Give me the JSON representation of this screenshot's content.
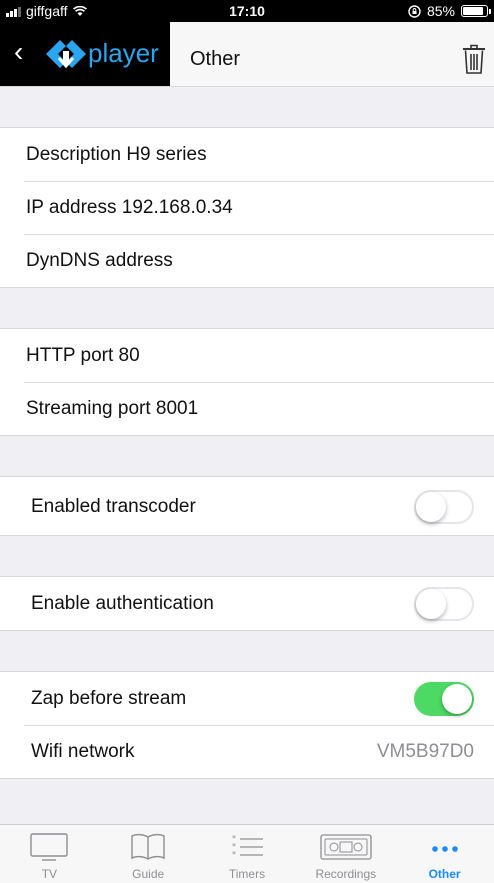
{
  "status_bar": {
    "carrier": "giffgaff",
    "time": "17:10",
    "battery_text": "85%",
    "battery_level": 0.85
  },
  "nav": {
    "app_name": "player",
    "title": "Other"
  },
  "settings": {
    "description": "Description  H9 series",
    "ip_address": "IP address  192.168.0.34",
    "dyndns": "DynDNS address",
    "http_port": "HTTP port  80",
    "streaming_port": "Streaming port  8001",
    "transcoder": {
      "label": "Enabled transcoder",
      "on": false
    },
    "authentication": {
      "label": "Enable authentication",
      "on": false
    },
    "zap": {
      "label": "Zap before stream",
      "on": true
    },
    "wifi": {
      "label": "Wifi network",
      "value": "VM5B97D0"
    }
  },
  "tabs": [
    {
      "label": "TV",
      "icon": "tv-icon"
    },
    {
      "label": "Guide",
      "icon": "book-icon"
    },
    {
      "label": "Timers",
      "icon": "list-icon"
    },
    {
      "label": "Recordings",
      "icon": "tape-icon"
    },
    {
      "label": "Other",
      "icon": "more-icon",
      "active": true
    }
  ],
  "colors": {
    "accent": "#1a8cff",
    "brand": "#2aa6f0",
    "toggle_on": "#4cd964"
  }
}
